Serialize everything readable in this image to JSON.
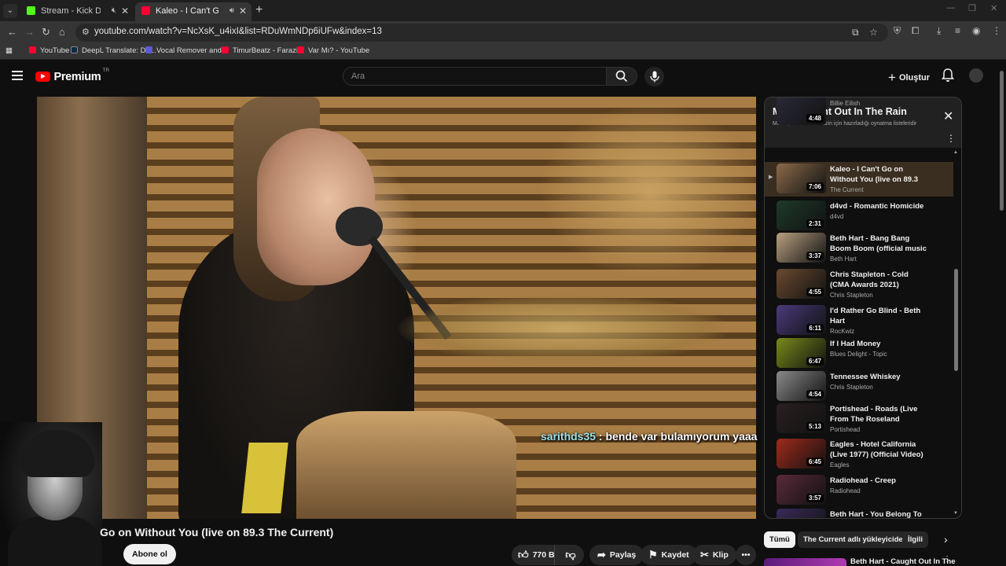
{
  "browser": {
    "tabs": [
      {
        "title": "Stream - Kick Dashboard",
        "favicon_color": "#53fc18",
        "muted_icon": "speaker-off-icon"
      },
      {
        "title": "Kaleo - I Can't Go on Witho",
        "favicon_color": "#ff0033",
        "audio_icon": "speaker-on-icon",
        "active": true
      }
    ],
    "new_tab": "+",
    "url": "youtube.com/watch?v=NcXsK_u4ixI&list=RDuWmNDp6iUFw&index=13",
    "bookmarks": [
      {
        "label": "YouTube",
        "color": "#ff0033"
      },
      {
        "label": "DeepL Translate: Dü...",
        "color": "#0f2b46"
      },
      {
        "label": "Vocal Remover and...",
        "color": "#5b5bd6"
      },
      {
        "label": "TimurBeatz - Farazi...",
        "color": "#ff0033"
      },
      {
        "label": "Var Mı? - YouTube",
        "color": "#ff0033"
      }
    ]
  },
  "header": {
    "logo_text": "Premium",
    "logo_region": "TR",
    "search_placeholder": "Ara",
    "create_label": "Oluştur"
  },
  "video": {
    "chat_user": "sarithds35",
    "chat_message": " : bende var bulamıyorum yaaa",
    "title": "Go on Without You (live on 89.3 The Current)",
    "subscribe_label": "Abone ol",
    "likes": "770 B",
    "share_label": "Paylaş",
    "save_label": "Kaydet",
    "clip_label": "Klip"
  },
  "playlist": {
    "title": "Mix - Caught Out In The Rain",
    "subtitle": "Mix'ler, YouTube'un sizin için hazırladığı oynatma listeleridir",
    "items": [
      {
        "title": "",
        "channel": "Billie Eilish",
        "duration": "4:48",
        "thumb": "#2a2a3a"
      },
      {
        "title": "Kaleo - I Can't Go on Without You (live on 89.3 The Current)",
        "channel": "The Current",
        "duration": "7:06",
        "thumb": "#8a6a4a",
        "active": true
      },
      {
        "title": "d4vd - Romantic Homicide",
        "channel": "d4vd",
        "duration": "2:31",
        "thumb": "#1e3a2a"
      },
      {
        "title": "Beth Hart - Bang Bang Boom Boom (official music video)...",
        "channel": "Beth Hart",
        "duration": "3:37",
        "thumb": "#b8a080"
      },
      {
        "title": "Chris Stapleton - Cold (CMA Awards 2021)",
        "channel": "Chris Stapleton",
        "duration": "4:55",
        "thumb": "#6a4a30"
      },
      {
        "title": "I'd Rather Go Blind - Beth Hart",
        "channel": "RocKwiz",
        "duration": "6:11",
        "thumb": "#4a3a7a"
      },
      {
        "title": "If I Had Money",
        "channel": "Blues Delight - Topic",
        "duration": "6:47",
        "thumb": "#7a8a1a"
      },
      {
        "title": "Tennessee Whiskey",
        "channel": "Chris Stapleton",
        "duration": "4:54",
        "thumb": "#8a8a8a"
      },
      {
        "title": "Portishead - Roads (Live From The Roseland Ballroom, NYC)",
        "channel": "Portishead",
        "duration": "5:13",
        "thumb": "#2a2020"
      },
      {
        "title": "Eagles - Hotel California (Live 1977) (Official Video) [HD]",
        "channel": "Eagles",
        "duration": "6:45",
        "thumb": "#a02a1a"
      },
      {
        "title": "Radiohead - Creep",
        "channel": "Radiohead",
        "duration": "3:57",
        "thumb": "#5a2a3a"
      },
      {
        "title": "Beth Hart - You Belong To Me -",
        "channel": "",
        "duration": "",
        "thumb": "#3a2a5a"
      }
    ]
  },
  "chips": [
    "Tümü",
    "The Current adlı yükleyiciden",
    "İlgili"
  ],
  "recommendation": {
    "title": "Beth Hart - Caught Out In The"
  }
}
